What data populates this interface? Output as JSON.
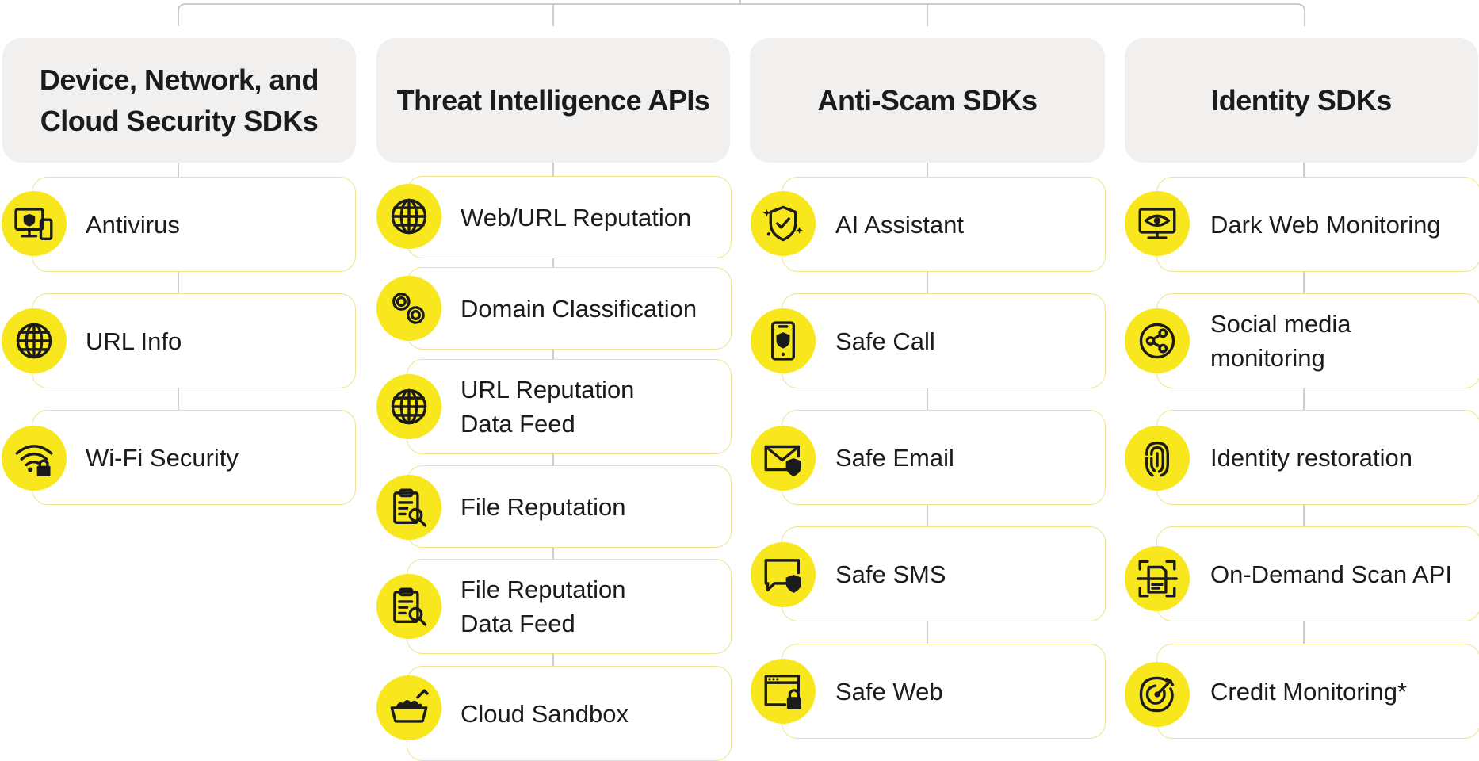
{
  "colors": {
    "accent": "#f8e71c",
    "card_border": "#ede58c",
    "header_bg": "#f2f0ee",
    "text": "#1b1b1b",
    "connector": "#bdbdbd"
  },
  "columns": [
    {
      "title": "Device, Network, and Cloud Security SDKs",
      "items": [
        {
          "label": "Antivirus",
          "icon": "monitor-shield-icon"
        },
        {
          "label": "URL Info",
          "icon": "globe-icon"
        },
        {
          "label": "Wi-Fi Security",
          "icon": "wifi-lock-icon"
        }
      ]
    },
    {
      "title": "Threat Intelligence APIs",
      "items": [
        {
          "label": "Web/URL Reputation",
          "icon": "globe-icon"
        },
        {
          "label": "Domain Classification",
          "icon": "gears-icon"
        },
        {
          "label": "URL Reputation Data Feed",
          "icon": "globe-icon"
        },
        {
          "label": "File Reputation",
          "icon": "clipboard-search-icon"
        },
        {
          "label": "File Reputation Data Feed",
          "icon": "clipboard-search-icon"
        },
        {
          "label": "Cloud Sandbox",
          "icon": "sandbox-icon"
        }
      ]
    },
    {
      "title": "Anti-Scam SDKs",
      "items": [
        {
          "label": "AI Assistant",
          "icon": "shield-check-sparkle-icon"
        },
        {
          "label": "Safe Call",
          "icon": "phone-shield-icon"
        },
        {
          "label": "Safe Email",
          "icon": "envelope-shield-icon"
        },
        {
          "label": "Safe SMS",
          "icon": "chat-shield-icon"
        },
        {
          "label": "Safe Web",
          "icon": "browser-lock-icon"
        }
      ]
    },
    {
      "title": "Identity SDKs",
      "items": [
        {
          "label": "Dark Web Monitoring",
          "icon": "monitor-eye-icon"
        },
        {
          "label": "Social media monitoring",
          "icon": "share-icon"
        },
        {
          "label": "Identity restoration",
          "icon": "fingerprint-icon"
        },
        {
          "label": "On-Demand Scan API",
          "icon": "document-scan-icon"
        },
        {
          "label": "Credit Monitoring*",
          "icon": "target-icon"
        }
      ]
    }
  ]
}
